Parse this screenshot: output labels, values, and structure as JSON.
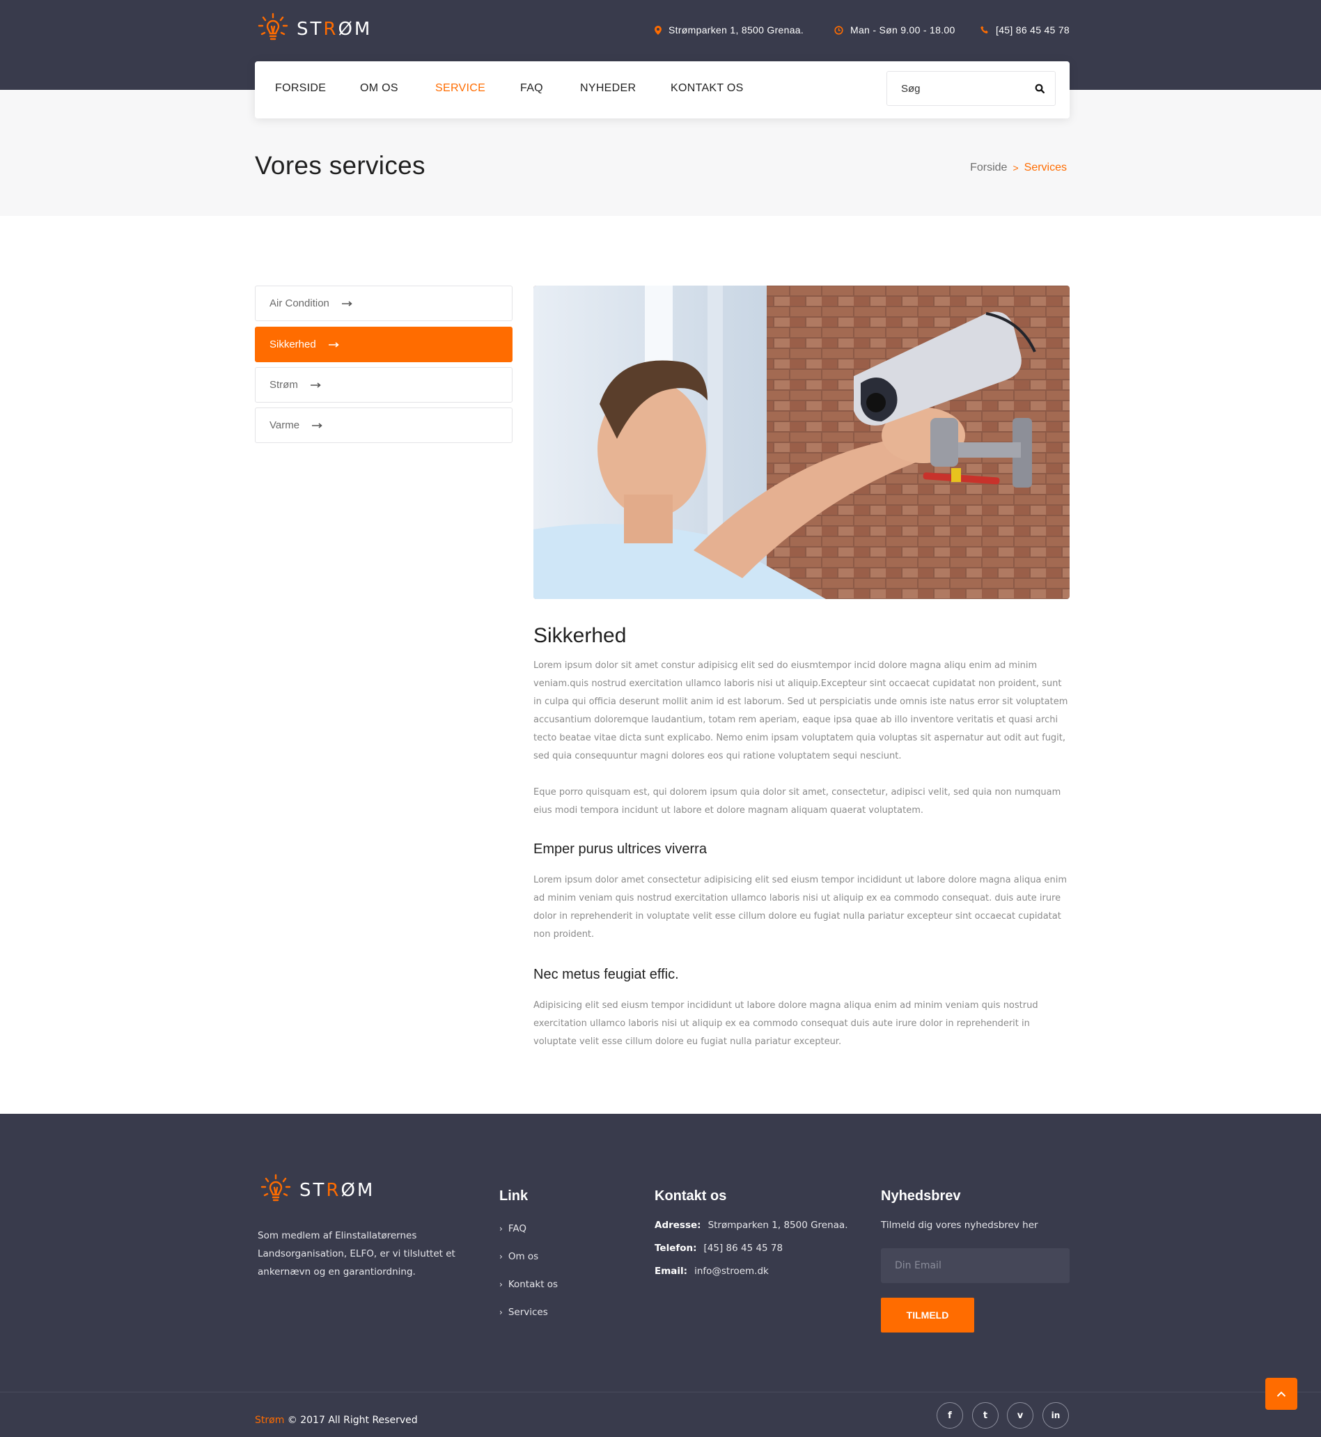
{
  "brand": {
    "name_pre": "ST",
    "name_hl": "R",
    "name_post": "ØM",
    "accent": "#ff6c00",
    "dark": "#393b4c"
  },
  "header": {
    "address": "Strømparken 1, 8500 Grenaa.",
    "hours": "Man - Søn 9.00 - 18.00",
    "phone": "[45] 86 45 45 78",
    "icons": {
      "address": "map-pin-icon",
      "hours": "clock-icon",
      "phone": "phone-icon"
    }
  },
  "nav": {
    "items": [
      "FORSIDE",
      "OM OS",
      "SERVICE",
      "FAQ",
      "NYHEDER",
      "KONTAKT OS"
    ],
    "active_index": 2,
    "search_placeholder": "Søg"
  },
  "page": {
    "title": "Vores services",
    "breadcrumb": {
      "home": "Forside",
      "separator": ">",
      "current": "Services"
    }
  },
  "sidebar": {
    "items": [
      "Air Condition",
      "Sikkerhed",
      "Strøm",
      "Varme"
    ],
    "active_index": 1
  },
  "content": {
    "image_subject": "technician installing security camera",
    "heading": "Sikkerhed",
    "p1": "Lorem ipsum dolor sit amet constur adipisicg elit sed do eiusmtempor incid dolore magna aliqu enim ad minim veniam.quis nostrud exercitation ullamco laboris nisi ut aliquip.Excepteur sint occaecat cupidatat non proident, sunt in culpa qui officia deserunt mollit anim id est laborum. Sed ut perspiciatis unde omnis iste natus error sit voluptatem accusantium doloremque laudantium, totam rem aperiam, eaque ipsa quae ab illo inventore veritatis et quasi archi tecto beatae vitae dicta sunt explicabo. Nemo enim ipsam voluptatem quia voluptas sit aspernatur aut odit aut fugit, sed quia consequuntur magni dolores eos qui ratione voluptatem sequi nesciunt.",
    "p2": "Eque porro quisquam est, qui dolorem ipsum quia dolor sit amet, consectetur, adipisci velit, sed quia non numquam eius modi tempora incidunt ut labore et dolore magnam aliquam quaerat voluptatem.",
    "sub1": "Emper purus ultrices viverra",
    "p3": "Lorem ipsum dolor amet consectetur adipisicing elit sed eiusm tempor incididunt ut labore dolore magna aliqua enim ad minim veniam quis nostrud exercitation ullamco laboris nisi ut aliquip ex ea commodo consequat. duis aute irure dolor in reprehenderit in voluptate velit esse cillum dolore eu fugiat nulla pariatur excepteur sint occaecat cupidatat non proident.",
    "sub2": "Nec metus feugiat effic.",
    "p4": "Adipisicing elit sed eiusm tempor incididunt ut labore dolore magna aliqua enim ad minim veniam quis nostrud exercitation ullamco laboris nisi ut aliquip ex ea commodo consequat duis aute irure dolor in reprehenderit in voluptate velit esse cillum dolore eu fugiat nulla pariatur excepteur."
  },
  "footer": {
    "about": "Som medlem af Elinstallatørernes Landsorganisation, ELFO, er vi tilsluttet et ankernævn og en garantiordning.",
    "links_title": "Link",
    "links": [
      "FAQ",
      "Om os",
      "Kontakt os",
      "Services"
    ],
    "contact_title": "Kontakt os",
    "contact": {
      "address_label": "Adresse:",
      "address": "Strømparken 1, 8500 Grenaa.",
      "phone_label": "Telefon:",
      "phone": "[45] 86 45 45 78",
      "email_label": "Email:",
      "email": "info@stroem.dk"
    },
    "newsletter_title": "Nyhedsbrev",
    "newsletter_text": "Tilmeld dig vores nyhedsbrev her",
    "email_placeholder": "Din Email",
    "subscribe_label": "TILMELD",
    "copyright_brand": "Strøm",
    "copyright_rest": " © 2017 All Right Reserved",
    "social": [
      {
        "name": "facebook-icon",
        "glyph": "f"
      },
      {
        "name": "twitter-icon",
        "glyph": "t"
      },
      {
        "name": "vimeo-icon",
        "glyph": "v"
      },
      {
        "name": "linkedin-icon",
        "glyph": "in"
      }
    ]
  }
}
